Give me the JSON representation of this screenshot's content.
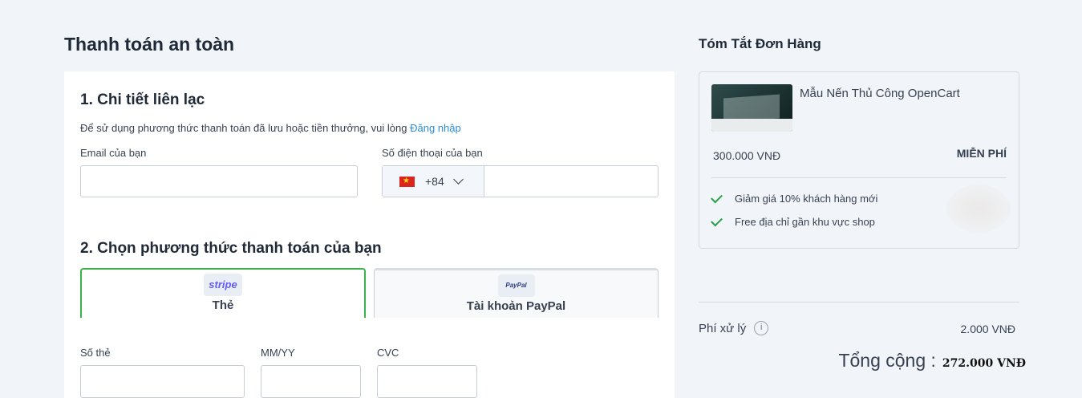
{
  "page_title": "Thanh toán an toàn",
  "contact": {
    "title": "1. Chi tiết liên lạc",
    "hint_text": "Để sử dụng phương thức thanh toán đã lưu hoặc tiền thưởng, vui lòng",
    "login_link": "Đăng nhập",
    "email_label": "Email của bạn",
    "email_value": "",
    "phone_label": "Số điện thoại của bạn",
    "phone_country": "VN",
    "phone_dial_code": "+84",
    "phone_value": ""
  },
  "payment": {
    "title": "2. Chọn phương thức thanh toán của bạn",
    "methods": [
      {
        "logo": "stripe",
        "label": "Thẻ",
        "selected": true
      },
      {
        "logo": "PayPal",
        "label": "Tài khoản PayPal",
        "selected": false
      }
    ],
    "card_number_label": "Số thẻ",
    "expiry_label": "MM/YY",
    "cvc_label": "CVC",
    "accent_color": "#3bb24a"
  },
  "summary": {
    "title": "Tóm Tắt Đơn Hàng",
    "product": {
      "name": "Mẫu Nến Thủ Công OpenCart",
      "thumbnail_icon": "candle-product-thumbnail",
      "price": "300.000 VNĐ",
      "shipping": "MIỄN PHÍ"
    },
    "perks": [
      "Giảm giá 10% khách hàng mới",
      "Free địa chỉ gần khu vực shop"
    ],
    "fee_label": "Phí xử lý",
    "fee_value": "2.000 VNĐ",
    "total_label": "Tổng cộng :",
    "total_value": "272.000 VNĐ"
  }
}
